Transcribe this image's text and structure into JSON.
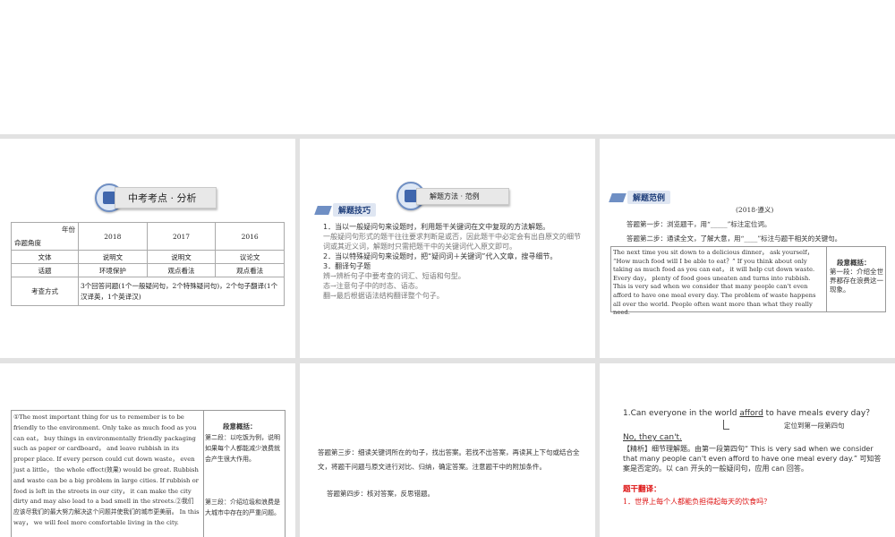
{
  "slide1": {
    "badge": "中考考点 · 分析",
    "table": {
      "corner_top": "年份",
      "corner_bottom": "命题角度",
      "years": [
        "2018",
        "2017",
        "2016"
      ],
      "rows": [
        {
          "label": "文体",
          "cells": [
            "说明文",
            "说明文",
            "议论文"
          ]
        },
        {
          "label": "话题",
          "cells": [
            "环境保护",
            "观点看法",
            "观点看法"
          ]
        }
      ],
      "method_label": "考查方式",
      "method_value": "3个回答问题(1个一般疑问句，2个特殊疑问句)，2个句子翻译(1个汉译英，1个英译汉)"
    }
  },
  "slide2": {
    "badge": "解题方法 · 范例",
    "tag": "解题技巧",
    "lines": [
      {
        "text": "1．当以一般疑问句来设题时，利用题干关键词在文中复现的方法解题。",
        "style": "dark"
      },
      {
        "text": "一般疑问句形式的题干往往要求判断是或否，因此题干中必定会有出自原文的细节词或其近义词，解题时只需把题干中的关键词代入原文即可。",
        "style": "light"
      },
      {
        "text": "2．当以特殊疑问句来设题时，把“疑问词＋关键词”代入文章，搜寻细节。",
        "style": "dark"
      },
      {
        "text": "3．翻译句子题",
        "style": "dark"
      },
      {
        "text": "辨→辨析句子中要考查的词汇、短语和句型。",
        "style": "light"
      },
      {
        "text": "态→注意句子中的时态、语态。",
        "style": "light"
      },
      {
        "text": "翻→最后根据语法结构翻译整个句子。",
        "style": "light"
      }
    ]
  },
  "slide3": {
    "tag": "解题范例",
    "source": "(2018·遵义)",
    "step1": "答题第一步：浏览题干，用“_____”标注定位词。",
    "step2": "答题第二步：通读全文，了解大意，用“____”标注与题干相关的关键句。",
    "passage": "The next time you sit down to a delicious dinner， ask yourself， “How much food will I be able to eat？” If you think about only taking as much food as you can eat， it will help cut down waste. Every day， plenty of food goes uneaten and turns into rubbish. This is very sad when we consider that many people can't even afford to have one meal every day. The problem of waste happens all over the world. People often want more than what they really need.",
    "summary_title": "段意概括：",
    "summary_text": "第一段：介绍全世界都存在浪费这一现象。"
  },
  "slide4": {
    "passage": "①The most important thing for us to remember is to be friendly to the environment. Only take as much food as you can eat， buy things in environmentally friendly packaging such as paper or cardboard， and leave rubbish in its proper place. If every person could cut down waste， even just a little， the whole effect(效果) would be great. Rubbish and waste can be a big problem in large cities. If rubbish or food is left in the streets in our city， it can make the city dirty and may also lead to a bad smell in the streets.②我们应该尽我们的最大努力解决这个问题并使我们的城市更美丽。 In this way， we will feel more comfortable living in the city.",
    "summary_title": "段意概括：",
    "summary_p2": "第二段：以吃饭为例，说明如果每个人都能减少浪费就会产生很大作用。",
    "summary_p3": "第三段：介绍垃圾和浪费是大城市中存在的严重问题。"
  },
  "slide5": {
    "step3": "答题第三步：细读关键词所在的句子，找出答案。若找不出答案，再读其上下句或结合全文，将题干问题与原文进行对比、归纳，确定答案。注意题干中的附加条件。",
    "step4": "答题第四步：核对答案，反思错题。"
  },
  "slide6": {
    "question": "1.Can everyone in the world afford to have meals every day？",
    "question_pre": "1.Can everyone in the world ",
    "question_key": "afford",
    "question_post": " to have meals every day？",
    "locate_note": "定位到第一段第四句",
    "answer": "No, they can't.",
    "analysis": "【精析】细节理解题。由第一段第四句“ This is very sad when we consider that many people can't even afford to have one meal every day.” 可知答案是否定的。以 can 开头的一般疑问句，应用 can 回答。",
    "translate_title": "题干翻译：",
    "translate_text": "1．世界上每个人都能负担得起每天的饮食吗？"
  }
}
